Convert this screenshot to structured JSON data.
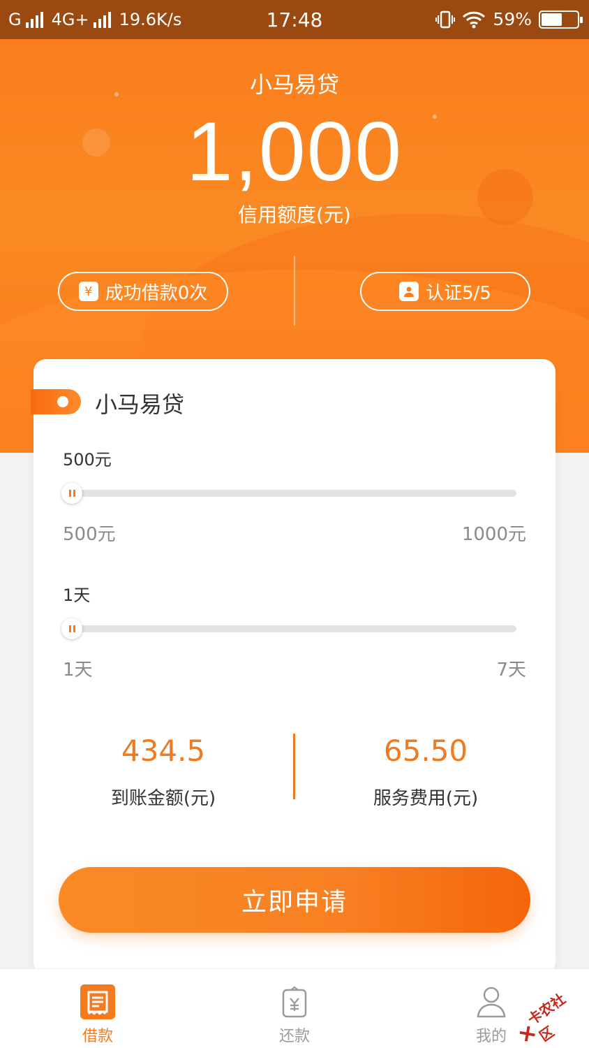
{
  "status_bar": {
    "carrier": "G",
    "network": "4G+",
    "speed": "19.6K/s",
    "time": "17:48",
    "battery": "59%"
  },
  "hero": {
    "title": "小马易贷",
    "amount": "1,000",
    "subtitle": "信用额度(元)",
    "loans_label": "成功借款0次",
    "auth_label": "认证5/5"
  },
  "card": {
    "title": "小马易贷",
    "amount_slider": {
      "value_label": "500元",
      "min_label": "500元",
      "max_label": "1000元",
      "fraction": 0.0
    },
    "days_slider": {
      "value_label": "1天",
      "min_label": "1天",
      "max_label": "7天",
      "fraction": 0.0
    },
    "received": {
      "value": "434.5",
      "label": "到账金额(元)"
    },
    "fee": {
      "value": "65.50",
      "label": "服务费用(元)"
    },
    "apply_label": "立即申请"
  },
  "tabs": [
    {
      "label": "借款",
      "icon": "loan-icon",
      "active": true
    },
    {
      "label": "还款",
      "icon": "repay-icon",
      "active": false
    },
    {
      "label": "我的",
      "icon": "profile-icon",
      "active": false
    }
  ],
  "watermark": "卡农社区",
  "colors": {
    "accent": "#f47a1e",
    "status_bar": "#9a4a10"
  }
}
